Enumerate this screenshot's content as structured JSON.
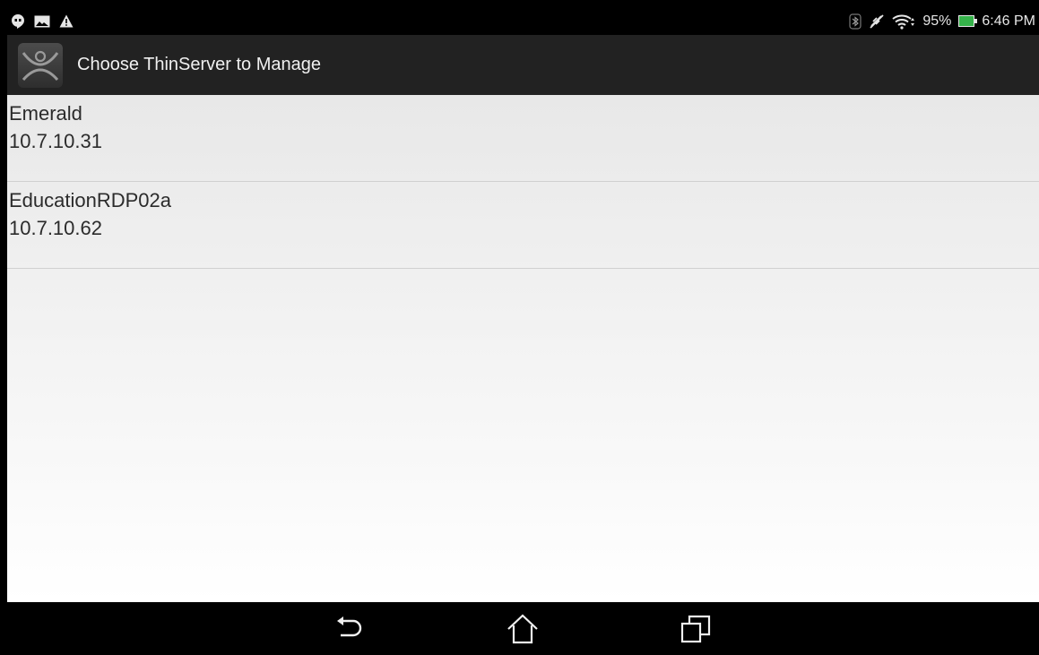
{
  "status_bar": {
    "left_icons": [
      "hangouts-icon",
      "gallery-icon",
      "warning-icon"
    ],
    "right_icons": [
      "bluetooth-icon",
      "no-sync-icon",
      "wifi-icon"
    ],
    "battery_percent": "95%",
    "time": "6:46 PM",
    "battery_color": "#35b34a"
  },
  "action_bar": {
    "title": "Choose ThinServer to Manage",
    "icon": "thinmanager-logo-icon",
    "background": "#222222"
  },
  "servers": [
    {
      "name": "Emerald",
      "ip": "10.7.10.31"
    },
    {
      "name": "EducationRDP02a",
      "ip": "10.7.10.62"
    }
  ],
  "nav_bar": {
    "buttons": [
      "back-icon",
      "home-icon",
      "recent-apps-icon"
    ]
  }
}
